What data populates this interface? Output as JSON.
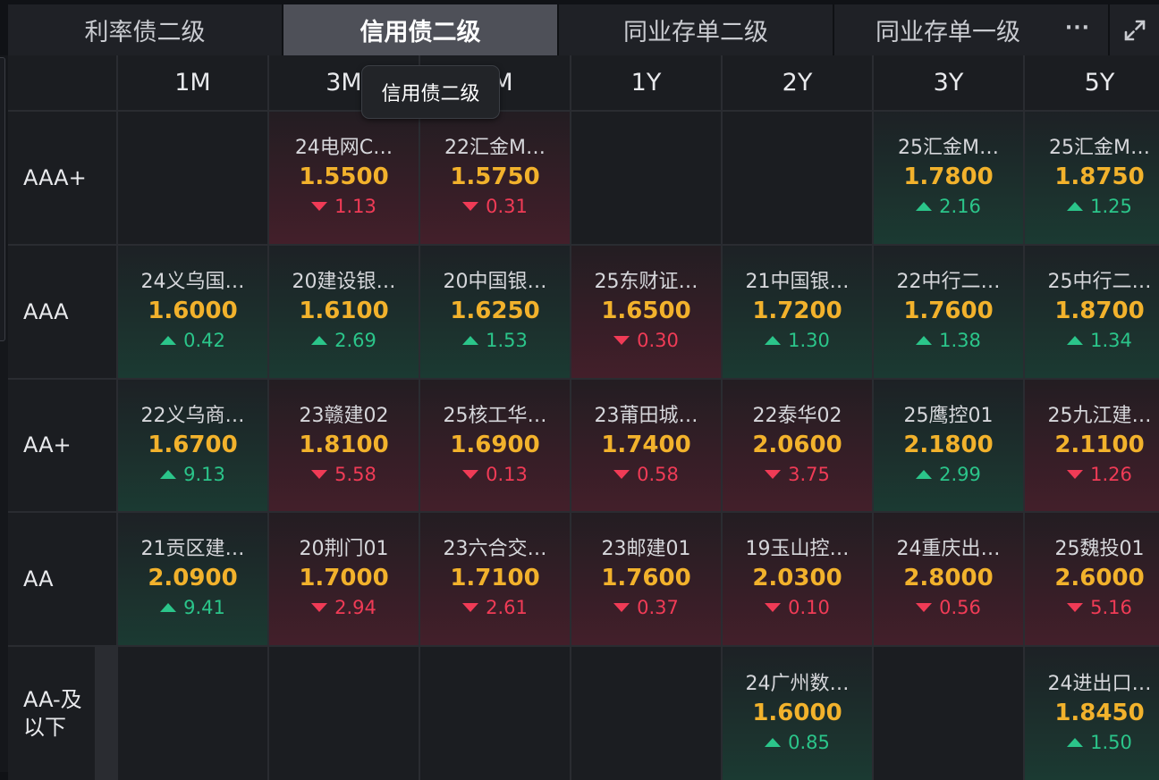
{
  "tabs": [
    {
      "label": "利率债二级",
      "active": false
    },
    {
      "label": "信用债二级",
      "active": true
    },
    {
      "label": "同业存单二级",
      "active": false
    },
    {
      "label": "同业存单一级",
      "active": false
    }
  ],
  "more_label": "···",
  "tooltip": "信用债二级",
  "colors": {
    "up": "#2bc58a",
    "down": "#f03b56",
    "price": "#f2b22c",
    "active_tab": "#4e5058"
  },
  "columns": [
    "1M",
    "3M",
    "6M",
    "1Y",
    "2Y",
    "3Y",
    "5Y"
  ],
  "rows": [
    {
      "label": "AAA+",
      "cells": [
        null,
        {
          "name": "24电网C…",
          "price": "1.5500",
          "change": "1.13",
          "dir": "down"
        },
        {
          "name": "22汇金M…",
          "price": "1.5750",
          "change": "0.31",
          "dir": "down"
        },
        null,
        null,
        {
          "name": "25汇金M…",
          "price": "1.7800",
          "change": "2.16",
          "dir": "up"
        },
        {
          "name": "25汇金M…",
          "price": "1.8750",
          "change": "1.25",
          "dir": "up"
        }
      ]
    },
    {
      "label": "AAA",
      "cells": [
        {
          "name": "24义乌国…",
          "price": "1.6000",
          "change": "0.42",
          "dir": "up"
        },
        {
          "name": "20建设银…",
          "price": "1.6100",
          "change": "2.69",
          "dir": "up"
        },
        {
          "name": "20中国银…",
          "price": "1.6250",
          "change": "1.53",
          "dir": "up"
        },
        {
          "name": "25东财证…",
          "price": "1.6500",
          "change": "0.30",
          "dir": "down"
        },
        {
          "name": "21中国银…",
          "price": "1.7200",
          "change": "1.30",
          "dir": "up"
        },
        {
          "name": "22中行二…",
          "price": "1.7600",
          "change": "1.38",
          "dir": "up"
        },
        {
          "name": "25中行二…",
          "price": "1.8700",
          "change": "1.34",
          "dir": "up"
        }
      ]
    },
    {
      "label": "AA+",
      "cells": [
        {
          "name": "22义乌商…",
          "price": "1.6700",
          "change": "9.13",
          "dir": "up"
        },
        {
          "name": "23赣建02",
          "price": "1.8100",
          "change": "5.58",
          "dir": "down"
        },
        {
          "name": "25核工华…",
          "price": "1.6900",
          "change": "0.13",
          "dir": "down"
        },
        {
          "name": "23莆田城…",
          "price": "1.7400",
          "change": "0.58",
          "dir": "down"
        },
        {
          "name": "22泰华02",
          "price": "2.0600",
          "change": "3.75",
          "dir": "down"
        },
        {
          "name": "25鹰控01",
          "price": "2.1800",
          "change": "2.99",
          "dir": "up"
        },
        {
          "name": "25九江建…",
          "price": "2.1100",
          "change": "1.26",
          "dir": "down"
        }
      ]
    },
    {
      "label": "AA",
      "cells": [
        {
          "name": "21贡区建…",
          "price": "2.0900",
          "change": "9.41",
          "dir": "up"
        },
        {
          "name": "20荆门01",
          "price": "1.7000",
          "change": "2.94",
          "dir": "down"
        },
        {
          "name": "23六合交…",
          "price": "1.7100",
          "change": "2.61",
          "dir": "down"
        },
        {
          "name": "23邮建01",
          "price": "1.7600",
          "change": "0.37",
          "dir": "down"
        },
        {
          "name": "19玉山控…",
          "price": "2.0300",
          "change": "0.10",
          "dir": "down"
        },
        {
          "name": "24重庆出…",
          "price": "2.8000",
          "change": "0.56",
          "dir": "down"
        },
        {
          "name": "25魏投01",
          "price": "2.6000",
          "change": "5.16",
          "dir": "down"
        }
      ]
    },
    {
      "label": "AA-及以下",
      "cells": [
        null,
        null,
        null,
        null,
        {
          "name": "24广州数…",
          "price": "1.6000",
          "change": "0.85",
          "dir": "up"
        },
        null,
        {
          "name": "24进出口…",
          "price": "1.8450",
          "change": "1.50",
          "dir": "up"
        }
      ]
    }
  ]
}
